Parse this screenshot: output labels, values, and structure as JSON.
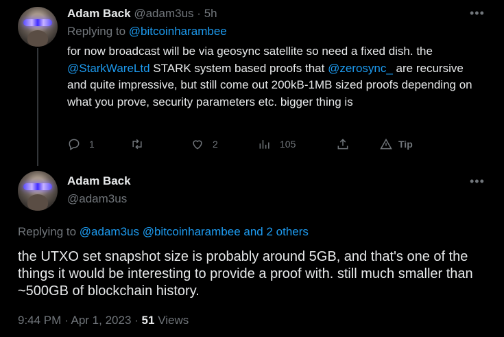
{
  "tweet1": {
    "author": "Adam Back",
    "handle": "@adam3us",
    "separator": "·",
    "age": "5h",
    "replying_prefix": "Replying to",
    "replying_to": "@bitcoinharambee",
    "text_parts": [
      "for now broadcast will be via geosync satellite so need a fixed dish. the ",
      "@StarkWareLtd",
      " STARK system based proofs that ",
      "@zerosync_",
      " are recursive and quite impressive, but still come out 200kB-1MB sized proofs depending on what you prove, security parameters etc. bigger thing is"
    ],
    "actions": {
      "replies": "1",
      "retweets": "",
      "likes": "2",
      "views": "105",
      "tip": "Tip"
    }
  },
  "tweet2": {
    "author": "Adam Back",
    "handle": "@adam3us",
    "replying_prefix": "Replying to",
    "replying_to": "@adam3us @bitcoinharambee and 2 others",
    "text": "the UTXO set snapshot size is probably around 5GB, and that's one of the things it would be interesting to provide a proof with. still much smaller than ~500GB of blockchain history.",
    "time": "9:44 PM",
    "date": "Apr 1, 2023",
    "views_count": "51",
    "views_label": "Views"
  },
  "icons": [
    "reply-icon",
    "retweet-icon",
    "like-icon",
    "views-icon",
    "share-icon",
    "tip-icon",
    "more-icon"
  ],
  "colors": {
    "background": "#000000",
    "text": "#e7e9ea",
    "muted": "#71767b",
    "link": "#1d9bf0"
  }
}
